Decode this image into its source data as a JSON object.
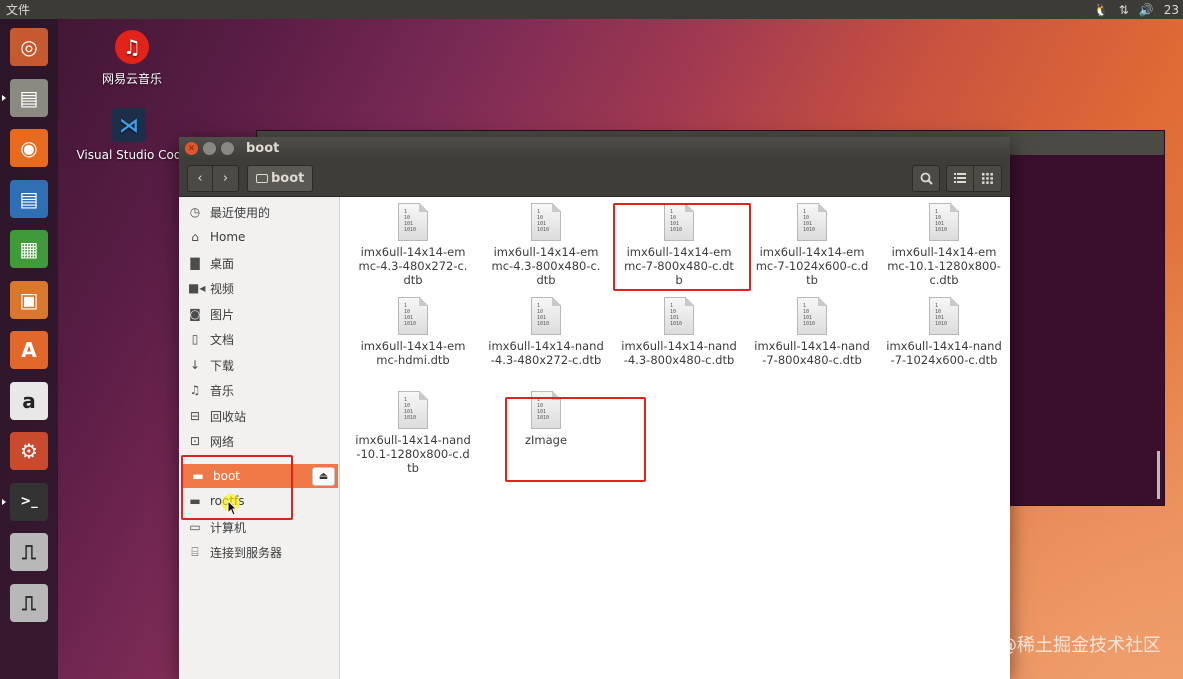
{
  "top_panel": {
    "app_menu": "文件",
    "indicators": [
      "🐧",
      "⇅",
      "🔊",
      "23"
    ]
  },
  "launcher": [
    {
      "name": "ubuntu-dash-icon",
      "color": "#c55a30"
    },
    {
      "name": "files-cabinet-icon",
      "color": "#8a8a80"
    },
    {
      "name": "firefox-icon",
      "color": "#e86a1f"
    },
    {
      "name": "libreoffice-writer-icon",
      "color": "#2f6fb4"
    },
    {
      "name": "libreoffice-calc-icon",
      "color": "#3f9a3a"
    },
    {
      "name": "libreoffice-impress-icon",
      "color": "#d9782d"
    },
    {
      "name": "software-center-icon",
      "color": "#e2672b"
    },
    {
      "name": "amazon-icon",
      "color": "#e8e8e8"
    },
    {
      "name": "system-settings-icon",
      "color": "#c94a2c"
    },
    {
      "name": "terminal-icon",
      "color": "#333333"
    },
    {
      "name": "usb-drive-icon",
      "color": "#b8b8b8"
    },
    {
      "name": "usb-drive-icon",
      "color": "#b8b8b8"
    }
  ],
  "desktop": {
    "icons": [
      {
        "label": "网易云音乐",
        "icon": "netease-music-icon"
      },
      {
        "label": "Visual Studio Cod",
        "icon": "vscode-icon"
      }
    ]
  },
  "window": {
    "title": "boot",
    "path_label": "boot"
  },
  "sidebar": {
    "items": [
      {
        "label": "最近使用的",
        "icon": "recent-icon",
        "glyph": "◷"
      },
      {
        "label": "Home",
        "icon": "home-icon",
        "glyph": "⌂"
      },
      {
        "label": "桌面",
        "icon": "folder-icon",
        "glyph": "▇"
      },
      {
        "label": "视频",
        "icon": "video-icon",
        "glyph": "■◂"
      },
      {
        "label": "图片",
        "icon": "camera-icon",
        "glyph": "◙"
      },
      {
        "label": "文档",
        "icon": "document-icon",
        "glyph": "▯"
      },
      {
        "label": "下载",
        "icon": "download-icon",
        "glyph": "↓"
      },
      {
        "label": "音乐",
        "icon": "music-icon",
        "glyph": "♫"
      },
      {
        "label": "回收站",
        "icon": "trash-icon",
        "glyph": "⊟"
      },
      {
        "label": "网络",
        "icon": "network-icon",
        "glyph": "⊡"
      },
      {
        "label": "boot",
        "icon": "drive-icon",
        "glyph": "▬",
        "active": true
      },
      {
        "label": "rootfs",
        "icon": "drive-icon",
        "glyph": "▬"
      },
      {
        "label": "计算机",
        "icon": "computer-icon",
        "glyph": "▭"
      },
      {
        "label": "连接到服务器",
        "icon": "server-icon",
        "glyph": "⌸"
      }
    ],
    "eject_glyph": "⏏"
  },
  "files": [
    {
      "name": "imx6ull-14x14-emmc-4.3-480x272-c.dtb"
    },
    {
      "name": "imx6ull-14x14-emmc-4.3-800x480-c.dtb"
    },
    {
      "name": "imx6ull-14x14-emmc-7-800x480-c.dtb"
    },
    {
      "name": "imx6ull-14x14-emmc-7-1024x600-c.dtb"
    },
    {
      "name": "imx6ull-14x14-emmc-10.1-1280x800-c.dtb"
    },
    {
      "name": "imx6ull-14x14-emmc-hdmi.dtb"
    },
    {
      "name": "imx6ull-14x14-nand-4.3-480x272-c.dtb"
    },
    {
      "name": "imx6ull-14x14-nand-4.3-800x480-c.dtb"
    },
    {
      "name": "imx6ull-14x14-nand-7-800x480-c.dtb"
    },
    {
      "name": "imx6ull-14x14-nand-7-1024x600-c.dtb"
    },
    {
      "name": "imx6ull-14x14-nand-10.1-1280x800-c.dtb"
    },
    {
      "name": "zImage"
    }
  ],
  "file_icon_text": "1\n10\n101\n1010",
  "watermark": "@稀土掘金技术社区",
  "colors": {
    "accent": "#f07746",
    "highlight": "#e0231c"
  }
}
